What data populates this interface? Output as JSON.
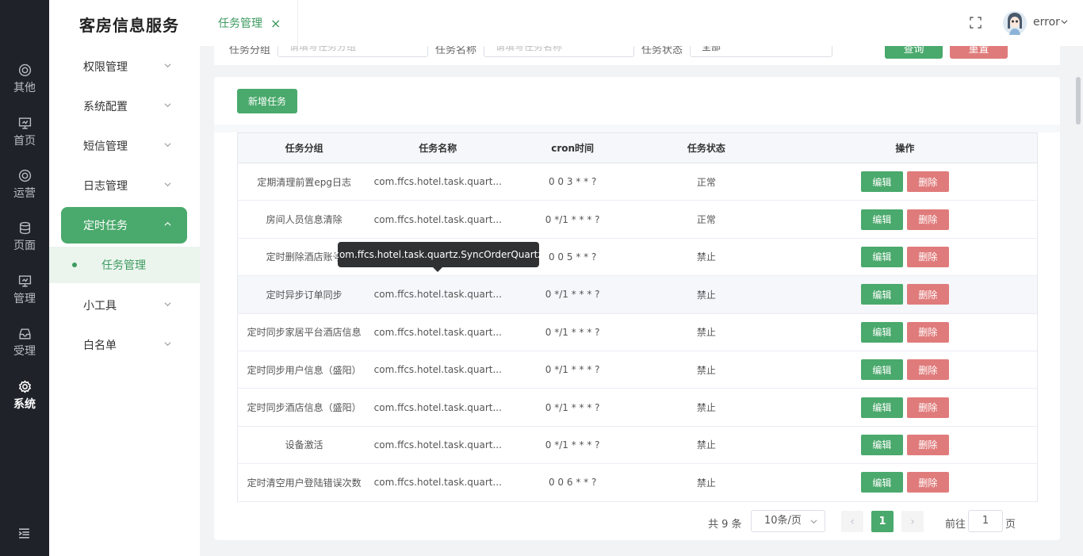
{
  "app": {
    "title": "客房信息服务"
  },
  "rail": {
    "items": [
      {
        "label": "其他",
        "icon": "target-icon"
      },
      {
        "label": "首页",
        "icon": "monitor-icon"
      },
      {
        "label": "运营",
        "icon": "target-icon"
      },
      {
        "label": "页面",
        "icon": "database-icon"
      },
      {
        "label": "管理",
        "icon": "monitor-icon"
      },
      {
        "label": "受理",
        "icon": "inbox-icon"
      },
      {
        "label": "系统",
        "icon": "gear-icon",
        "active": true
      }
    ],
    "collapse_icon": "menu-fold-icon"
  },
  "sidebar": {
    "items": [
      {
        "label": "权限管理"
      },
      {
        "label": "系统配置"
      },
      {
        "label": "短信管理"
      },
      {
        "label": "日志管理"
      },
      {
        "label": "定时任务",
        "active": true
      },
      {
        "label": "小工具"
      },
      {
        "label": "白名单"
      }
    ],
    "active_child": "任务管理"
  },
  "header": {
    "tab_label": "任务管理",
    "tab_close": "×",
    "username": "error"
  },
  "filters": {
    "group_label": "任务分组",
    "group_placeholder": "请填写任务分组",
    "name_label": "任务名称",
    "name_placeholder": "请填写任务名称",
    "status_label": "任务状态",
    "status_value": "全部",
    "query_label": "查询",
    "reset_label": "重置"
  },
  "toolbar": {
    "add_label": "新增任务"
  },
  "table": {
    "columns": [
      "任务分组",
      "任务名称",
      "cron时间",
      "任务状态",
      "操作"
    ],
    "edit_label": "编辑",
    "delete_label": "删除",
    "rows": [
      {
        "group": "定期清理前置epg日志",
        "name": "com.ffcs.hotel.task.quart...",
        "cron": "0 0 3 * * ?",
        "status": "正常"
      },
      {
        "group": "房间人员信息清除",
        "name": "com.ffcs.hotel.task.quart...",
        "cron": "0 */1 * * * ?",
        "status": "正常"
      },
      {
        "group": "定时删除酒店账号",
        "name": "com.ffcs.hotel.task.quart...",
        "cron": "0 0 5 * * ?",
        "status": "禁止"
      },
      {
        "group": "定时异步订单同步",
        "name": "com.ffcs.hotel.task.quart...",
        "cron": "0 */1 * * * ?",
        "status": "禁止"
      },
      {
        "group": "定时同步家居平台酒店信息",
        "name": "com.ffcs.hotel.task.quart...",
        "cron": "0 */1 * * * ?",
        "status": "禁止"
      },
      {
        "group": "定时同步用户信息（盛阳）",
        "name": "com.ffcs.hotel.task.quart...",
        "cron": "0 */1 * * * ?",
        "status": "禁止"
      },
      {
        "group": "定时同步酒店信息（盛阳）",
        "name": "com.ffcs.hotel.task.quart...",
        "cron": "0 */1 * * * ?",
        "status": "禁止"
      },
      {
        "group": "设备激活",
        "name": "com.ffcs.hotel.task.quart...",
        "cron": "0 */1 * * * ?",
        "status": "禁止"
      },
      {
        "group": "定时清空用户登陆错误次数",
        "name": "com.ffcs.hotel.task.quart...",
        "cron": "0 0 6 * * ?",
        "status": "禁止"
      }
    ]
  },
  "tooltip": {
    "text": "com.ffcs.hotel.task.quartz.SyncOrderQuartz"
  },
  "pagination": {
    "total": "共 9 条",
    "page_size": "10条/页",
    "current_page": "1",
    "prev": "‹",
    "next": "›",
    "goto_label": "前往",
    "goto_value": "1",
    "page_suffix": "页"
  },
  "colors": {
    "primary": "#4aa96c",
    "danger": "#e07b7b",
    "rail_bg": "#1f2329"
  }
}
